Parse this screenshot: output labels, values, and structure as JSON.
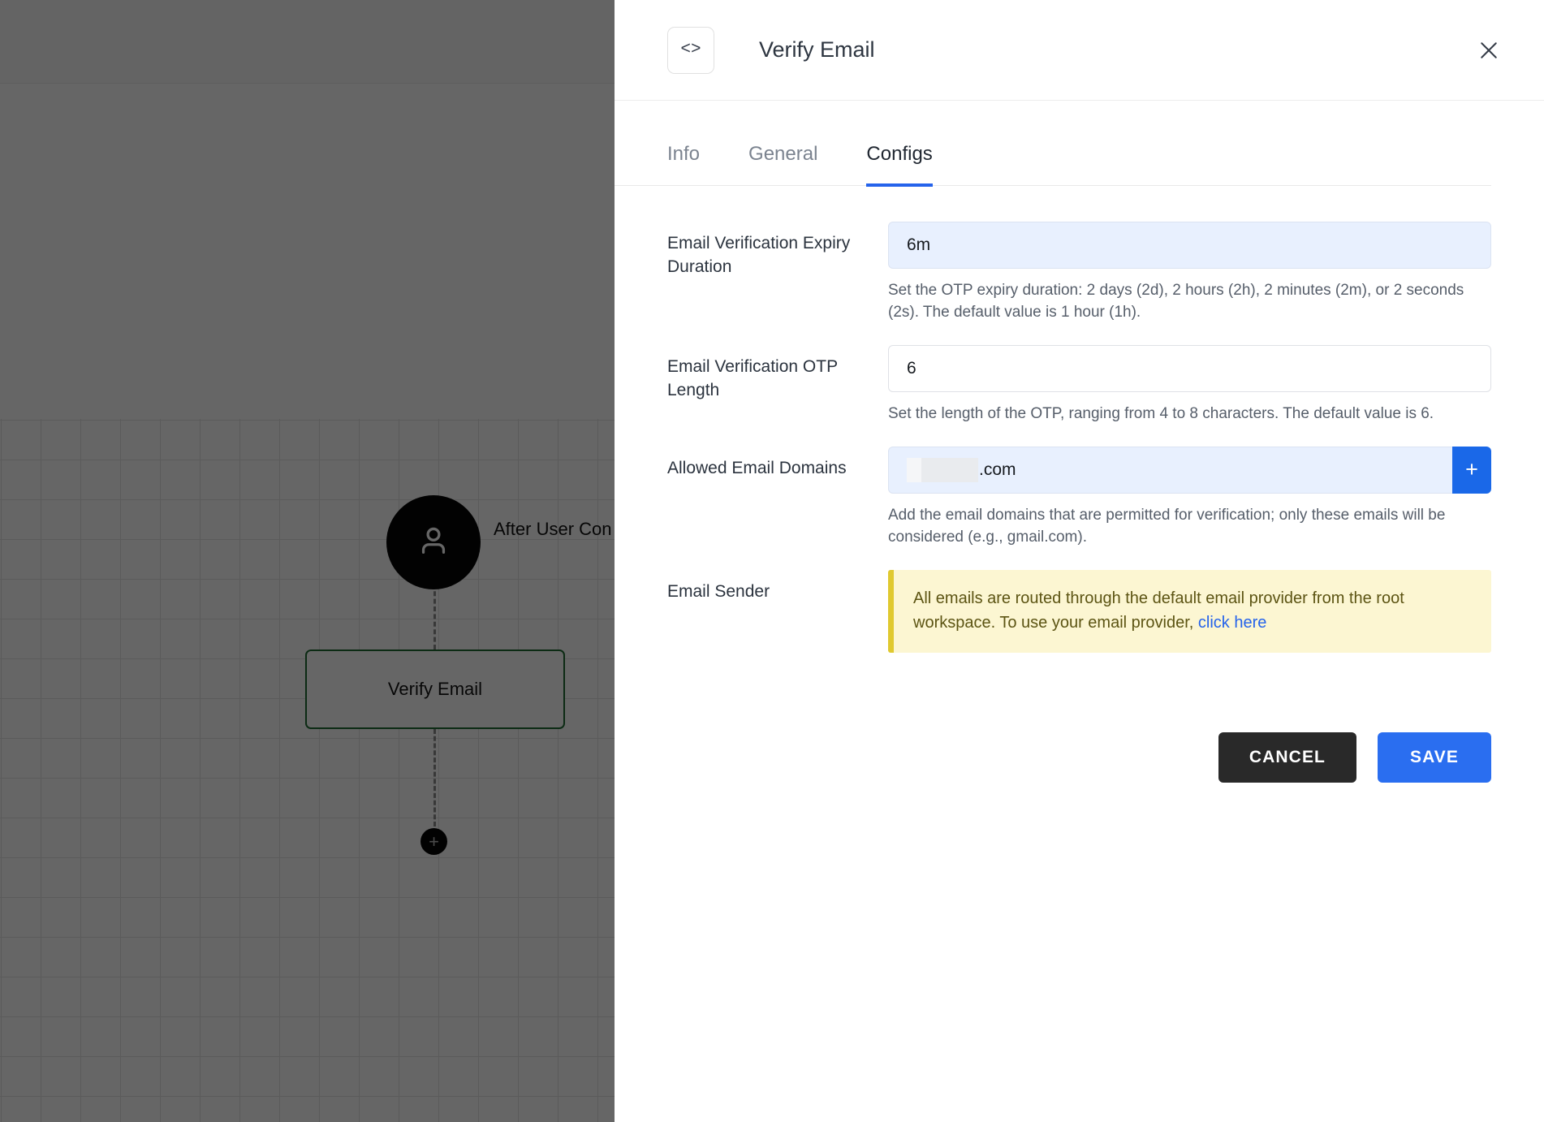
{
  "canvas": {
    "avatar_icon": "user-icon",
    "trigger_caption": "After User Con",
    "node_label": "Verify Email",
    "add_node_glyph": "+"
  },
  "panel": {
    "code_icon_glyph": "<>",
    "title": "Verify Email",
    "close_glyph": "×",
    "tabs": [
      {
        "label": "Info",
        "active": false
      },
      {
        "label": "General",
        "active": false
      },
      {
        "label": "Configs",
        "active": true
      }
    ],
    "fields": {
      "expiry": {
        "label": "Email Verification Expiry Duration",
        "value": "6m",
        "placeholder": "",
        "help": "Set the OTP expiry duration: 2 days (2d), 2 hours (2h), 2 minutes (2m), or 2 seconds (2s). The default value is 1 hour (1h)."
      },
      "otp_length": {
        "label": "Email Verification OTP Length",
        "value": "6",
        "placeholder": "",
        "help": "Set the length of the OTP, ranging from 4 to 8 characters. The default value is 6."
      },
      "domains": {
        "label": "Allowed Email Domains",
        "value_suffix": ".com",
        "add_button_glyph": "+",
        "help": "Add the email domains that are permitted for verification; only these emails will be considered (e.g., gmail.com)."
      },
      "sender": {
        "label": "Email Sender",
        "notice_text": "All emails are routed through the default email provider from the root workspace. To use your email provider,",
        "notice_link": "click here"
      }
    },
    "buttons": {
      "cancel": "CANCEL",
      "save": "SAVE"
    }
  },
  "colors": {
    "accent_blue": "#2563eb",
    "save_blue": "#2a6ef0",
    "add_blue": "#1a68e8",
    "cancel_dark": "#292929",
    "notice_bg": "#fcf6d2",
    "notice_border": "#e0c92f",
    "autofill_bg": "#e8f0fe",
    "node_border_green": "#1f6b33"
  }
}
